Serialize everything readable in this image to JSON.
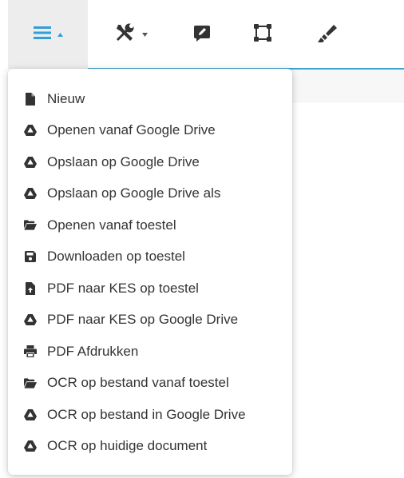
{
  "toolbar": {
    "buttons": [
      {
        "name": "hamburger-menu-button",
        "icon": "hamburger-icon",
        "has_caret": true,
        "color": "#2f9fd8",
        "active": true
      },
      {
        "name": "tools-button",
        "icon": "tools-icon",
        "has_caret": true,
        "color": "#333333",
        "active": false
      },
      {
        "name": "annotate-button",
        "icon": "pen-square-icon",
        "has_caret": false,
        "color": "#333333",
        "active": false
      },
      {
        "name": "crop-button",
        "icon": "vector-square-icon",
        "has_caret": false,
        "color": "#333333",
        "active": false
      },
      {
        "name": "highlighter-button",
        "icon": "highlighter-icon",
        "has_caret": false,
        "color": "#333333",
        "active": false
      }
    ],
    "accent_color": "#3aa3d8"
  },
  "menu": {
    "items": [
      {
        "label": "Nieuw",
        "icon": "file-icon"
      },
      {
        "label": "Openen vanaf Google Drive",
        "icon": "google-drive-icon"
      },
      {
        "label": "Opslaan op Google Drive",
        "icon": "google-drive-icon"
      },
      {
        "label": "Opslaan op Google Drive als",
        "icon": "google-drive-icon"
      },
      {
        "label": "Openen vanaf toestel",
        "icon": "folder-open-icon"
      },
      {
        "label": "Downloaden op toestel",
        "icon": "save-icon"
      },
      {
        "label": "PDF naar KES op toestel",
        "icon": "file-upload-icon"
      },
      {
        "label": "PDF naar KES op Google Drive",
        "icon": "google-drive-icon"
      },
      {
        "label": "PDF Afdrukken",
        "icon": "print-icon"
      },
      {
        "label": "OCR op bestand vanaf toestel",
        "icon": "folder-open-icon"
      },
      {
        "label": "OCR op bestand in Google Drive",
        "icon": "google-drive-icon"
      },
      {
        "label": "OCR op huidige document",
        "icon": "google-drive-icon"
      }
    ]
  }
}
